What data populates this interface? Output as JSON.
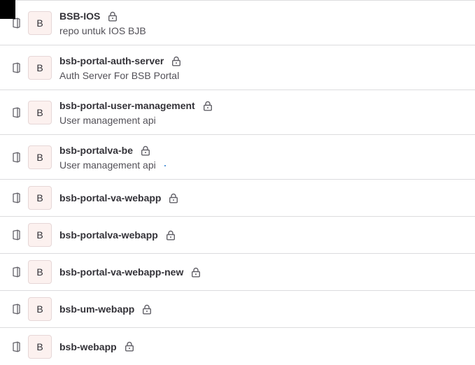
{
  "projects": [
    {
      "avatar_letter": "B",
      "name": "BSB-IOS",
      "description": "repo untuk IOS BJB",
      "visibility_icon": "lock-icon",
      "type_icon": "book-icon"
    },
    {
      "avatar_letter": "B",
      "name": "bsb-portal-auth-server",
      "description": "Auth Server For BSB Portal",
      "visibility_icon": "lock-icon",
      "type_icon": "book-icon"
    },
    {
      "avatar_letter": "B",
      "name": "bsb-portal-user-management",
      "description": "User management api",
      "visibility_icon": "lock-icon",
      "type_icon": "book-icon"
    },
    {
      "avatar_letter": "B",
      "name": "bsb-portalva-be",
      "description": "User management api",
      "visibility_icon": "lock-icon",
      "type_icon": "book-icon"
    },
    {
      "avatar_letter": "B",
      "name": "bsb-portal-va-webapp",
      "description": "",
      "visibility_icon": "lock-icon",
      "type_icon": "book-icon"
    },
    {
      "avatar_letter": "B",
      "name": "bsb-portalva-webapp",
      "description": "",
      "visibility_icon": "lock-icon",
      "type_icon": "book-icon"
    },
    {
      "avatar_letter": "B",
      "name": "bsb-portal-va-webapp-new",
      "description": "",
      "visibility_icon": "lock-icon",
      "type_icon": "book-icon"
    },
    {
      "avatar_letter": "B",
      "name": "bsb-um-webapp",
      "description": "",
      "visibility_icon": "lock-icon",
      "type_icon": "book-icon"
    },
    {
      "avatar_letter": "B",
      "name": "bsb-webapp",
      "description": "",
      "visibility_icon": "lock-icon",
      "type_icon": "book-icon"
    }
  ],
  "colors": {
    "avatar_bg": "#fcf1ef",
    "text_primary": "#333238",
    "text_secondary": "#535158",
    "divider": "#dcdcde"
  }
}
